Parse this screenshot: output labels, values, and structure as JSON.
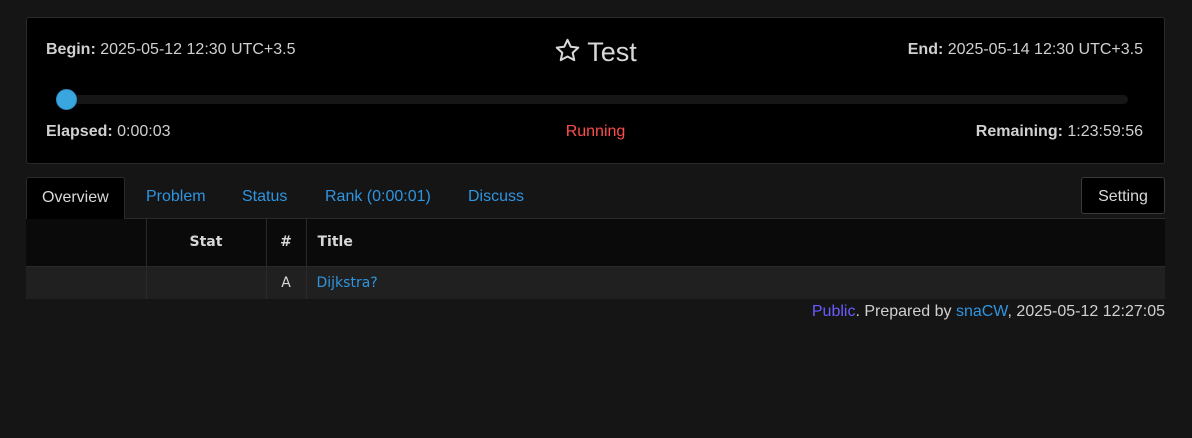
{
  "contest": {
    "title": "Test",
    "begin_label": "Begin:",
    "begin_value": "2025-05-12 12:30 UTC+3.5",
    "end_label": "End:",
    "end_value": "2025-05-14 12:30 UTC+3.5",
    "elapsed_label": "Elapsed:",
    "elapsed_value": "0:00:03",
    "status": "Running",
    "remaining_label": "Remaining:",
    "remaining_value": "1:23:59:56",
    "progress_percent": 0.003
  },
  "tabs": [
    {
      "label": "Overview",
      "active": true
    },
    {
      "label": "Problem",
      "active": false
    },
    {
      "label": "Status",
      "active": false
    },
    {
      "label": "Rank (0:00:01)",
      "active": false
    },
    {
      "label": "Discuss",
      "active": false
    }
  ],
  "setting_label": "Setting",
  "table": {
    "headers": [
      "",
      "Stat",
      "#",
      "Title"
    ],
    "rows": [
      {
        "col0": "",
        "stat": "",
        "num": "A",
        "title": "Dijkstra?"
      }
    ]
  },
  "footer": {
    "visibility": "Public",
    "prepared_by": ". Prepared by ",
    "author": "snaCW",
    "timestamp": ", 2025-05-12 12:27:05"
  },
  "colors": {
    "accent": "#3aa6e0",
    "link": "#2f95e0",
    "running": "#ff4d4d",
    "public": "#6a5cff"
  },
  "icons": {
    "title_icon": "star-outline-icon"
  }
}
